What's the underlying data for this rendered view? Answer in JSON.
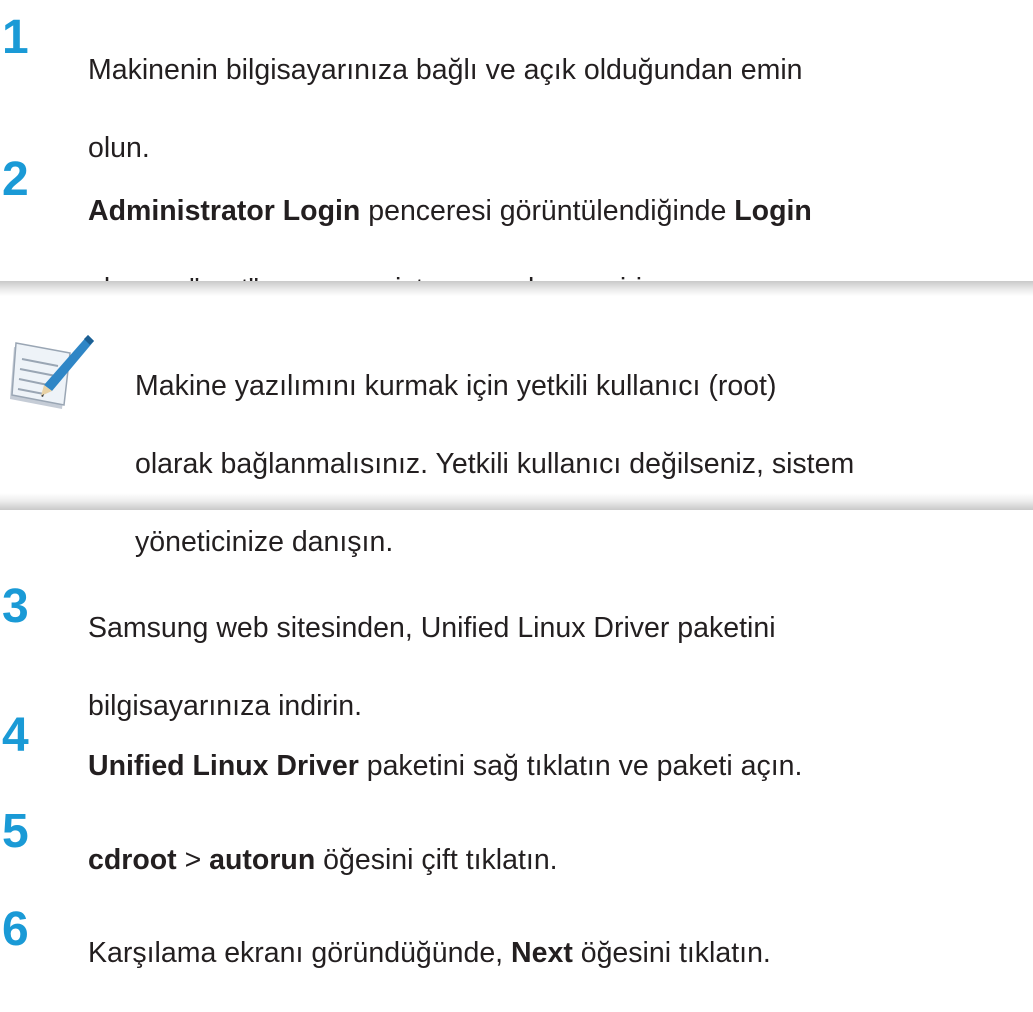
{
  "steps": [
    {
      "number": "1",
      "line1": "Makinenin bilgisayarınıza bağlı ve açık olduğundan emin",
      "line2": "olun."
    },
    {
      "number": "2",
      "line1_bold_a": "Administrator Login",
      "line1_mid": " penceresi görüntülendiğinde ",
      "line1_bold_b": "Login",
      "line2": "alanına \"root\" yazın ve sistem parolasını girin."
    },
    {
      "number": "3",
      "line1": "Samsung web sitesinden, Unified Linux Driver paketini",
      "line2": "bilgisayarınıza indirin."
    },
    {
      "number": "4",
      "bold": "Unified Linux Driver",
      "rest": " paketini sağ tıklatın ve paketi açın."
    },
    {
      "number": "5",
      "bold_a": "cdroot",
      "sep": " > ",
      "bold_b": "autorun",
      "rest": " öğesini çift tıklatın."
    },
    {
      "number": "6",
      "pre": "Karşılama ekranı göründüğünde, ",
      "bold": "Next",
      "rest": " öğesini tıklatın."
    }
  ],
  "note": {
    "icon": "note-pencil-icon",
    "line1": "Makine yazılımını kurmak için yetkili kullanıcı (root)",
    "line2": "olarak bağlanmalısınız. Yetkili kullanıcı değilseniz, sistem",
    "line3": "yöneticinize danışın."
  },
  "colors": {
    "step_number": "#1a9ad6",
    "text": "#231f20",
    "note_band": "#c9c9c9"
  }
}
